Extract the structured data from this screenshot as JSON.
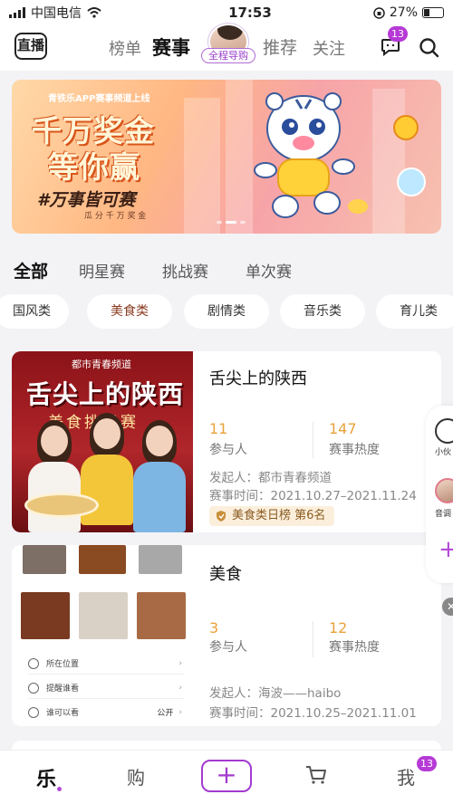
{
  "status_bar": {
    "carrier": "中国电信",
    "time": "17:53",
    "battery": "27%"
  },
  "top_nav": {
    "logo": "直播",
    "tabs": [
      "榜单",
      "赛事",
      "推荐",
      "关注"
    ],
    "active_tab": "赛事",
    "guide_label": "全程导购",
    "message_badge": "13"
  },
  "banner": {
    "top_text": "青铁乐APP赛事频道上线",
    "headline_1": "千万奖金",
    "headline_2": "等你赢",
    "slogan": "#万事皆可赛",
    "sub": "瓜 分 千 万 奖 金"
  },
  "category_tabs": [
    "全部",
    "明星赛",
    "挑战赛",
    "单次赛"
  ],
  "chips": [
    "国风类",
    "美食类",
    "剧情类",
    "音乐类",
    "育儿类"
  ],
  "cards": [
    {
      "title": "舌尖上的陕西",
      "poster_brand": "都市青春频道",
      "poster_title": "舌尖上的陕西",
      "poster_sub": "美食挑战赛",
      "participants": "11",
      "participants_label": "参与人",
      "heat": "147",
      "heat_label": "赛事热度",
      "initiator": "发起人：都市青春频道",
      "period": "赛事时间：2021.10.27–2021.11.24",
      "rank": "美食类日榜  第6名"
    },
    {
      "title": "美食",
      "participants": "3",
      "participants_label": "参与人",
      "heat": "12",
      "heat_label": "赛事热度",
      "initiator": "发起人：海波——haibo",
      "period": "赛事时间：2021.10.25–2021.11.01",
      "post_settings": [
        {
          "label": "所在位置",
          "value": ""
        },
        {
          "label": "提醒谁看",
          "value": ""
        },
        {
          "label": "谁可以看",
          "value": "公开"
        }
      ]
    }
  ],
  "float_panel": {
    "item1": "小伙",
    "item2": "音调"
  },
  "tab_bar": {
    "items": [
      "乐",
      "购",
      "+",
      "",
      "我"
    ],
    "badge": "13"
  },
  "colors": {
    "accent": "#a43ad0",
    "stat": "#e9a23a",
    "rank_bg": "#fbefdc"
  }
}
